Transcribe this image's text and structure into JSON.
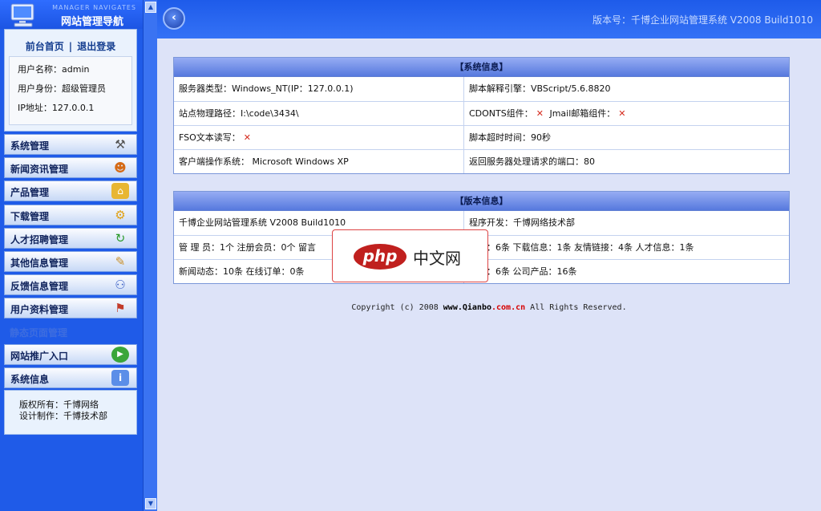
{
  "brand": {
    "subtitle_en": "MANAGER NAVIGATES",
    "title": "网站管理导航"
  },
  "user_panel": {
    "home_link": "前台首页",
    "separator": "|",
    "logout_link": "退出登录",
    "username": "用户名称：admin",
    "role": "用户身份：超级管理员",
    "ip": "IP地址：127.0.0.1"
  },
  "sidebar": {
    "items": [
      {
        "label": "系统管理",
        "icon": "tools-icon"
      },
      {
        "label": "新闻资讯管理",
        "icon": "users-group-icon"
      },
      {
        "label": "产品管理",
        "icon": "lock-icon"
      },
      {
        "label": "下载管理",
        "icon": "gears-icon"
      },
      {
        "label": "人才招聘管理",
        "icon": "refresh-icon"
      },
      {
        "label": "其他信息管理",
        "icon": "edit-note-icon"
      },
      {
        "label": "反馈信息管理",
        "icon": "user-search-icon"
      },
      {
        "label": "用户资料管理",
        "icon": "user-network-icon"
      }
    ],
    "static_pages": "静态页面管理",
    "promo": {
      "label": "网站推广入口",
      "icon": "play-icon"
    },
    "sysinfo": {
      "label": "系统信息",
      "icon": "info-icon"
    },
    "copyright_owner": "版权所有：千博网络",
    "designer": "设计制作：千博技术部"
  },
  "header": {
    "version_label": "版本号：千博企业网站管理系统 V2008 Build1010"
  },
  "system_info": {
    "title": "【系统信息】",
    "server_type": "服务器类型：Windows_NT(IP：127.0.0.1)",
    "script_engine": "脚本解释引擎：VBScript/5.6.8820",
    "physical_path": "站点物理路径：I:\\code\\3434\\",
    "cdonts_label": "CDONTS组件：",
    "jmail_label": "Jmail邮箱组件：",
    "fso_label": "FSO文本读写：",
    "x_mark": "✕",
    "timeout": "脚本超时时间：90秒",
    "client_os": "客户端操作系统： Microsoft Windows XP",
    "port": "返回服务器处理请求的端口：80"
  },
  "version_info": {
    "title": "【版本信息】",
    "system_name": "千博企业网站管理系统 V2008 Build1010",
    "developer": "程序开发：千博网络技术部",
    "counts_left": "管 理 员：1个 注册会员：0个 留言",
    "counts_right": "信息：6条 下载信息：1条 友情链接：4条 人才信息：1条",
    "news_left": "新闻动态：10条 在线订单：0条",
    "news_right": "信息：6条 公司产品：16条"
  },
  "copyright": {
    "prefix": "Copyright (c) 2008 ",
    "site": "www.Qianbo",
    "domain": ".com.cn",
    "suffix": " All Rights Reserved."
  },
  "watermark": {
    "logo": "php",
    "text": "中文网"
  },
  "colors": {
    "sidebar_blue": "#1f5be8",
    "content_bg": "#dde3f8",
    "panel_title": "#6d89e6",
    "x_mark_red": "#d52b1e"
  }
}
